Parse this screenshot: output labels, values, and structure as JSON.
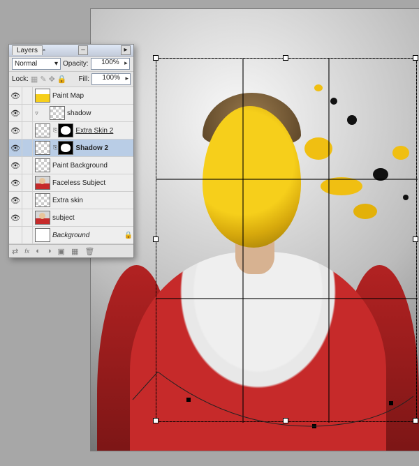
{
  "panel": {
    "tab": "Layers",
    "close_x": "x",
    "blend_mode": "Normal",
    "opacity_label": "Opacity:",
    "opacity_value": "100%",
    "lock_label": "Lock:",
    "fill_label": "Fill:",
    "fill_value": "100%"
  },
  "layers": [
    {
      "name": "Paint Map",
      "thumb": "yellow",
      "visible": true
    },
    {
      "name": "shadow",
      "thumb": "chk",
      "indent": true,
      "arrow": true,
      "visible": true
    },
    {
      "name": "Extra Skin 2",
      "thumb": "chk",
      "mask": "black",
      "underline": true,
      "visible": true
    },
    {
      "name": "Shadow 2",
      "thumb": "chk",
      "mask": "black",
      "selected": true,
      "bold": true,
      "visible": true
    },
    {
      "name": "Paint Background",
      "thumb": "chk",
      "visible": true
    },
    {
      "name": "Faceless Subject",
      "thumb": "photo",
      "visible": true
    },
    {
      "name": "Extra skin",
      "thumb": "chk",
      "visible": true
    },
    {
      "name": "subject",
      "thumb": "photo",
      "visible": true
    },
    {
      "name": "Background",
      "thumb": "white",
      "italic": true,
      "locked": true,
      "visible": false
    }
  ],
  "footer_icons": [
    "link-icon",
    "fx-icon",
    "mask-icon",
    "adjustment-icon",
    "group-icon",
    "new-layer-icon",
    "trash-icon"
  ],
  "colors": {
    "accent": "#f6cf1b",
    "panel_sel": "#b9cde6",
    "red": "#c62a2a"
  }
}
